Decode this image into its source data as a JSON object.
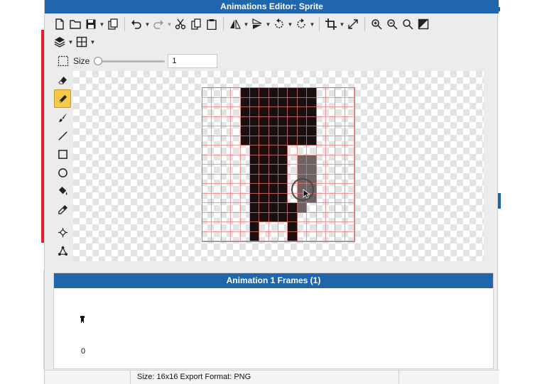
{
  "window": {
    "title": "Animations Editor: Sprite"
  },
  "toolbar": {
    "row1": [
      "new-file-icon",
      "open-folder-icon",
      "save-icon",
      "export-icon",
      "undo-icon",
      "redo-icon",
      "cut-icon",
      "copy-icon",
      "paste-icon",
      "flip-horizontal-icon",
      "flip-vertical-icon",
      "rotate-left-icon",
      "rotate-right-icon",
      "crop-icon",
      "resize-icon",
      "zoom-in-icon",
      "zoom-out-icon",
      "zoom-fit-icon",
      "fill-screen-icon"
    ],
    "row2": [
      "layers-icon",
      "grid-icon"
    ]
  },
  "brush": {
    "size_label": "Size",
    "size_value": "1",
    "slider_fraction": 0.0
  },
  "tools": [
    "selection-icon",
    "eraser-icon",
    "pencil-icon",
    "brush-icon",
    "line-icon",
    "rectangle-icon",
    "circle-icon",
    "paint-bucket-icon",
    "eyedropper-icon",
    "move-point-icon",
    "vertex-icon"
  ],
  "active_tool": "pencil-icon",
  "sprite": {
    "colors": {
      "0": "transparent",
      "1": "#1b1010",
      "2": "#6e6262"
    },
    "grid_color": "#ec7878",
    "pixels": [
      "0000111111110000",
      "0000111111110000",
      "0000111111110000",
      "0000111111110000",
      "0000111111110000",
      "0000111111110000",
      "0000011110000000",
      "0000011110220000",
      "0000011110220000",
      "0000011110220000",
      "0000011110220000",
      "0000011110220000",
      "0000011111200000",
      "0000011111000000",
      "0000010001000000",
      "0000010001000000"
    ]
  },
  "frames": {
    "header": "Animation 1 Frames (1)",
    "items": [
      {
        "index": "0"
      }
    ]
  },
  "status": {
    "text": "Size: 16x16   Export Format: PNG"
  },
  "colors": {
    "title_bar": "#1f66ad",
    "active_tool": "#f3c84b"
  }
}
